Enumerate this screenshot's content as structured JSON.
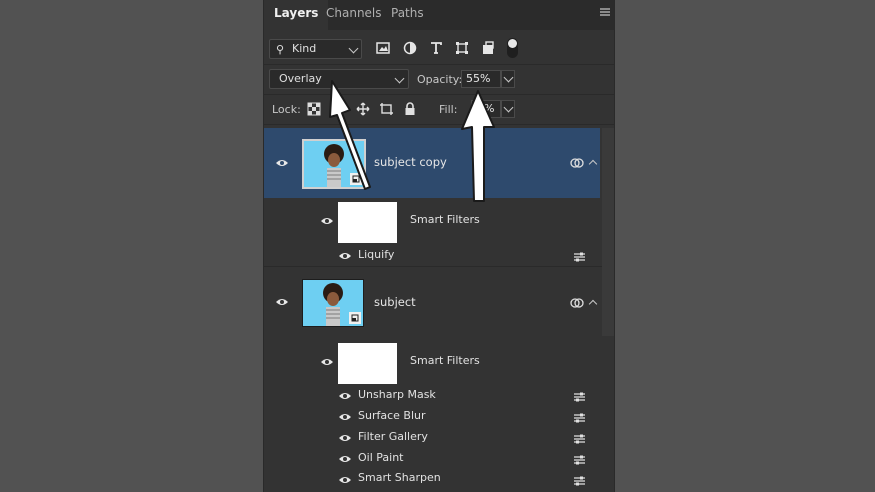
{
  "panel": {
    "tabs": [
      "Layers",
      "Channels",
      "Paths"
    ],
    "active_tab": "Layers"
  },
  "filter": {
    "kind_label": "Kind"
  },
  "blend": {
    "mode": "Overlay",
    "opacity_label": "Opacity:",
    "opacity_value": "55%"
  },
  "lock": {
    "label": "Lock:",
    "fill_label": "Fill:",
    "fill_value": "%"
  },
  "layers": [
    {
      "name": "subject copy",
      "selected": true,
      "smart_filters_label": "Smart Filters",
      "filters": [
        "Liquify"
      ]
    },
    {
      "name": "subject",
      "selected": false,
      "smart_filters_label": "Smart Filters",
      "filters": [
        "Unsharp Mask",
        "Surface Blur",
        "Filter Gallery",
        "Oil Paint",
        "Smart Sharpen"
      ]
    }
  ],
  "colors": {
    "background": "#525252",
    "panel": "#333333",
    "selected_row": "#2e4a6d",
    "thumbnail_bg": "#6ecff2"
  }
}
